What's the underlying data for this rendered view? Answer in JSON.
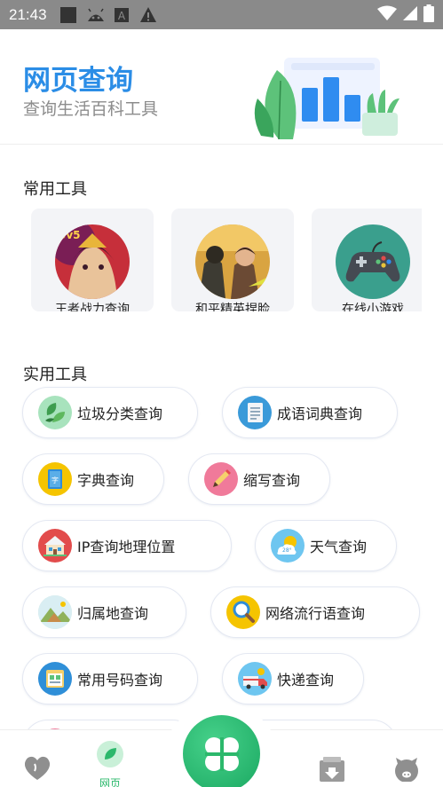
{
  "status_bar": {
    "time": "21:43",
    "icons": [
      "square-icon",
      "android-icon",
      "a-box-icon",
      "warning-icon",
      "wifi-icon",
      "signal-icon",
      "battery-icon"
    ]
  },
  "header": {
    "title": "网页查询",
    "subtitle": "查询生活百科工具"
  },
  "sections": {
    "common_title": "常用工具",
    "useful_title": "实用工具"
  },
  "common_tools": [
    {
      "label": "王者战力查询",
      "icon": "game-hero-avatar"
    },
    {
      "label": "和平精英捏脸",
      "icon": "game-soldier-avatar"
    },
    {
      "label": "在线小游戏",
      "icon": "gamepad-icon"
    }
  ],
  "useful_tools": [
    {
      "label": "垃圾分类查询",
      "icon": "leaves-icon",
      "color": "#8fd9a8"
    },
    {
      "label": "成语词典查询",
      "icon": "document-icon",
      "color": "#3a9ad9"
    },
    {
      "label": "字典查询",
      "icon": "book-icon",
      "color": "#f5c400"
    },
    {
      "label": "缩写查询",
      "icon": "pencil-icon",
      "color": "#f07a9a"
    },
    {
      "label": "IP查询地理位置",
      "icon": "house-icon",
      "color": "#e24c4c"
    },
    {
      "label": "天气查询",
      "icon": "weather-icon",
      "color": "#6ec6f0"
    },
    {
      "label": "归属地查询",
      "icon": "mountain-icon",
      "color": "#f5d06b"
    },
    {
      "label": "网络流行语查询",
      "icon": "magnifier-icon",
      "color": "#f5c400"
    },
    {
      "label": "常用号码查询",
      "icon": "phone-book-icon",
      "color": "#2f8fd8"
    },
    {
      "label": "快递查询",
      "icon": "truck-icon",
      "color": "#6ec6f0"
    }
  ],
  "bottom_nav": {
    "active_label": "网页",
    "items": [
      "heart-icon",
      "leaf-icon",
      "clover-icon",
      "download-box-icon",
      "pig-icon"
    ]
  },
  "colors": {
    "accent_blue": "#2b8de6",
    "accent_green": "#2cb86c",
    "status_bar": "#8a8a8a"
  }
}
